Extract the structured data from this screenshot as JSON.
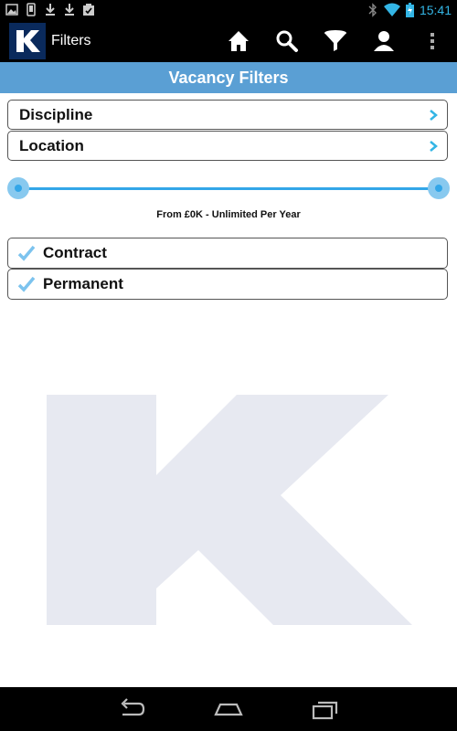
{
  "status_bar": {
    "time": "15:41",
    "left_icons": [
      "image-icon",
      "phone-icon",
      "download-icon",
      "download-icon",
      "clipboard-check-icon"
    ],
    "right_icons": [
      "bluetooth-icon",
      "wifi-icon",
      "battery-icon"
    ]
  },
  "action_bar": {
    "logo_letter": "K",
    "title": "Filters",
    "buttons": [
      "home-icon",
      "search-icon",
      "filter-icon",
      "profile-icon",
      "overflow-menu-icon"
    ]
  },
  "page": {
    "title": "Vacancy Filters"
  },
  "filters": {
    "discipline_label": "Discipline",
    "location_label": "Location",
    "salary_range_text": "From £0K  - Unlimited Per Year",
    "salary_slider": {
      "min_fraction": 0.0,
      "max_fraction": 1.0
    }
  },
  "job_types": [
    {
      "label": "Contract",
      "checked": true
    },
    {
      "label": "Permanent",
      "checked": true
    }
  ],
  "watermark": {
    "letter": "K"
  },
  "nav_bar": {
    "buttons": [
      "back-icon",
      "home-nav-icon",
      "recent-apps-icon"
    ]
  },
  "colors": {
    "accent": "#33b5e5",
    "title_bar": "#5a9fd4",
    "slider": "#33a6e8",
    "watermark": "#e7e9f1"
  }
}
